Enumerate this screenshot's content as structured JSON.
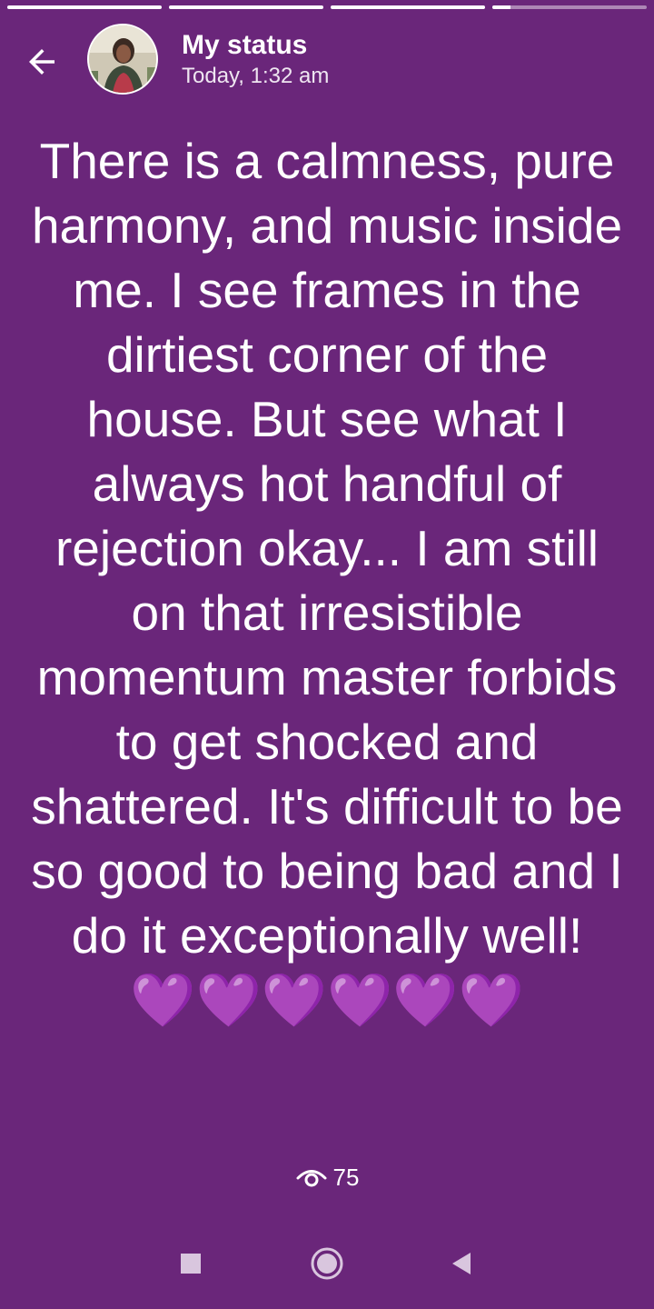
{
  "progress": {
    "segments": [
      1,
      1,
      1,
      0.12
    ]
  },
  "header": {
    "back_icon": "arrow-left-icon",
    "title": "My status",
    "time": "Today, 1:32 am"
  },
  "status": {
    "text": "There is a calmness, pure harmony, and music inside me. I see frames in the dirtiest corner of the house. But see what I always hot handful of rejection okay... I am still on that irresistible momentum master forbids to get shocked and shattered. It's difficult to be so good to being bad and I do it exceptionally well!",
    "hearts": [
      "💜",
      "💜",
      "💜",
      "💜",
      "💜",
      "💜"
    ],
    "background_color": "#6a267a",
    "heart_color": "#9a5ce6"
  },
  "views": {
    "icon": "eye-icon",
    "count": "75"
  },
  "nav": {
    "recents_icon": "square-icon",
    "home_icon": "circle-icon",
    "back_icon": "triangle-back-icon"
  }
}
